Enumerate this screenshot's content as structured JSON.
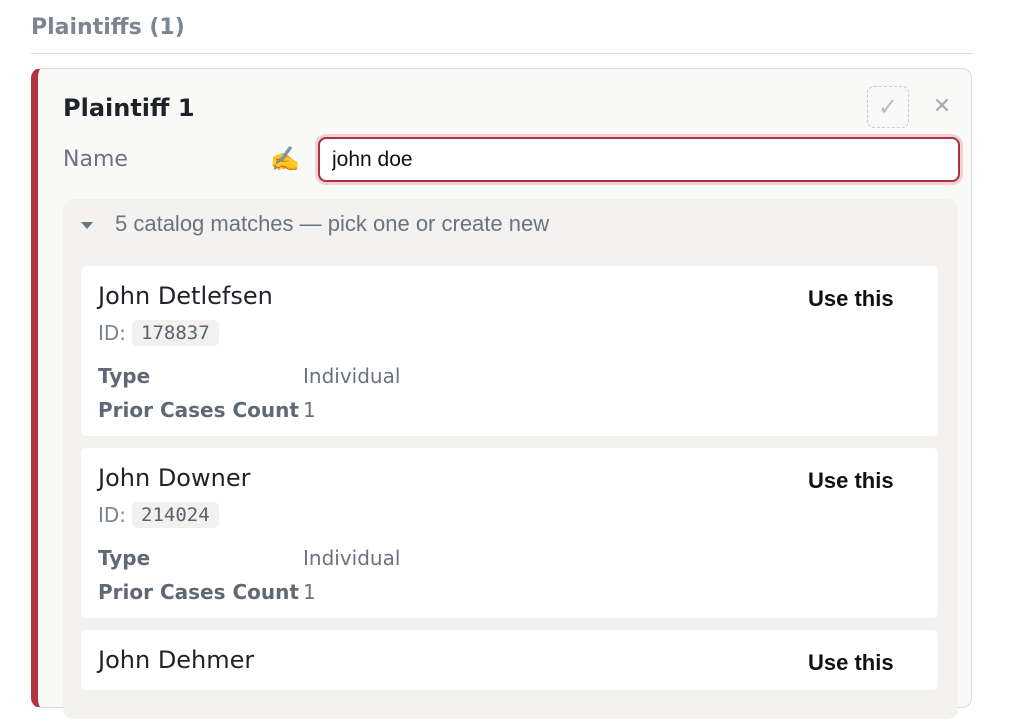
{
  "section": {
    "title": "Plaintiffs (1)"
  },
  "plaintiff": {
    "title": "Plaintiff 1",
    "confirm_symbol": "✓",
    "remove_symbol": "✕",
    "name_label": "Name",
    "hint_symbol": "✍️",
    "name_value": "john doe"
  },
  "matches": {
    "summary": "5 catalog matches — pick one or create new",
    "use_label": "Use this",
    "id_label": "ID:",
    "type_label": "Type",
    "prior_label": "Prior Cases Count",
    "items": [
      {
        "name": "John Detlefsen",
        "id": "178837",
        "type": "Individual",
        "prior": "1"
      },
      {
        "name": "John Downer",
        "id": "214024",
        "type": "Individual",
        "prior": "1"
      },
      {
        "name": "John Dehmer"
      }
    ]
  },
  "colors": {
    "accent": "#b0343f",
    "input_border": "#a63340"
  },
  "icons": {
    "confirm": "check-icon",
    "remove": "close-icon",
    "hint": "writing-hand-icon",
    "caret": "caret-down-icon"
  }
}
